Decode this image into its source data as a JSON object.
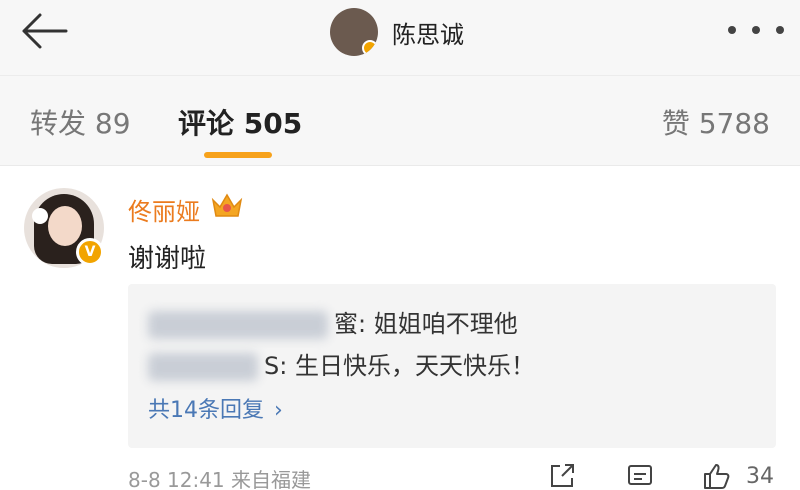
{
  "header": {
    "title": "陈思诚"
  },
  "tabs": {
    "repost": "转发 89",
    "comments": "评论 505",
    "likes": "赞 5788"
  },
  "comment": {
    "username": "佟丽娅",
    "text": "谢谢啦",
    "badge_glyph": "V",
    "replies": [
      {
        "author_visible": "蜜",
        "text": ": 姐姐咱不理他"
      },
      {
        "author_visible": "S",
        "text": ": 生日快乐，天天快乐！"
      }
    ],
    "more_replies": "共14条回复",
    "more_replies_chevron": "›",
    "time_location": "8-8 12:41 来自福建",
    "like_count": "34"
  },
  "colors": {
    "accent": "#f7a21b",
    "username": "#eb7b1e",
    "link": "#4a78b5"
  },
  "icons": [
    "back-arrow-icon",
    "more-dots-icon",
    "crown-icon",
    "share-icon",
    "comment-icon",
    "like-icon",
    "verified-badge-icon"
  ]
}
